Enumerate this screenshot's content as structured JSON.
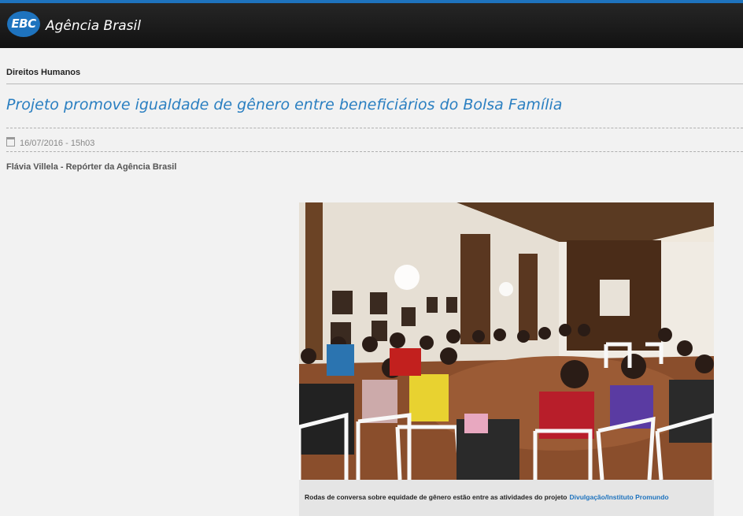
{
  "header": {
    "logo_text": "EBC",
    "brand": "Agência Brasil",
    "accent_color": "#1e73be"
  },
  "article": {
    "section": "Direitos Humanos",
    "title": "Projeto promove igualdade de gênero entre beneficiários do Bolsa Família",
    "date": "16/07/2016 - 15h03",
    "author": "Flávia Villela - Repórter da Agência Brasil"
  },
  "figure": {
    "caption": "Rodas de conversa sobre equidade de gênero estão entre as atividades do projeto",
    "credit": "Divulgação/Instituto Promundo"
  }
}
